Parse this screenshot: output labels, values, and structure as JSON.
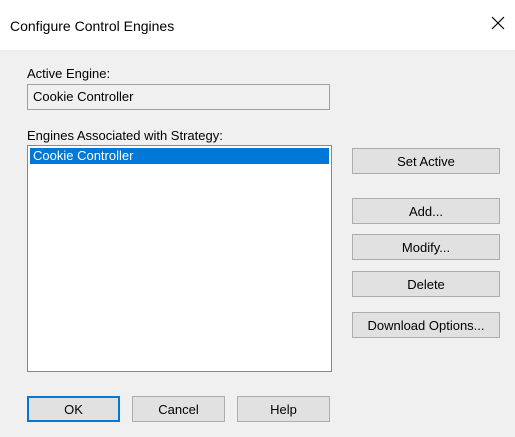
{
  "window": {
    "title": "Configure Control Engines",
    "close_label": "×"
  },
  "active_engine": {
    "label": "Active Engine:",
    "value": "Cookie Controller"
  },
  "engines_list": {
    "label": "Engines Associated with Strategy:",
    "items": [
      "Cookie Controller"
    ],
    "selected_index": 0
  },
  "actions": {
    "set_active": "Set Active",
    "add": "Add...",
    "modify": "Modify...",
    "delete": "Delete",
    "download_options": "Download Options..."
  },
  "footer": {
    "ok": "OK",
    "cancel": "Cancel",
    "help": "Help"
  },
  "colors": {
    "selection": "#0078d7",
    "dialog_bg": "#f0f0f0",
    "button_bg": "#e1e1e1"
  }
}
